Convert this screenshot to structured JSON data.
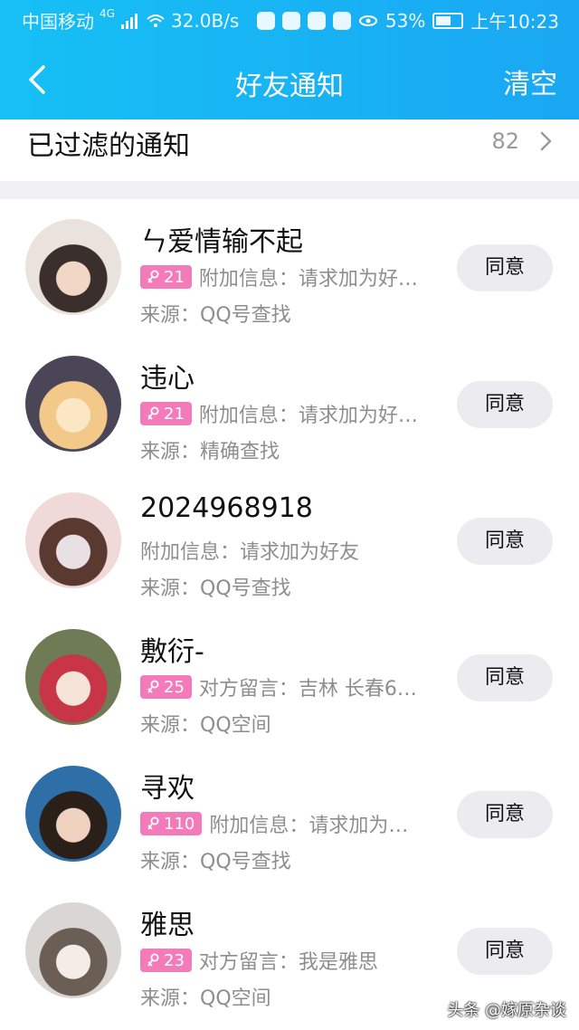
{
  "status_bar": {
    "carrier": "中国移动",
    "network": "4G",
    "speed": "32.0B/s",
    "battery": "53%",
    "time": "上午10:23"
  },
  "nav": {
    "title": "好友通知",
    "clear_label": "清空"
  },
  "filtered": {
    "label": "已过滤的通知",
    "count": "82"
  },
  "requests": [
    {
      "name": "ㄣ爱情输不起",
      "age": "21",
      "info": "附加信息：请求加为好…",
      "source": "来源：QQ号查找",
      "button": "同意",
      "avatar_colors": [
        "#e9e2dd",
        "#3a2f2c",
        "#f2d6c6"
      ]
    },
    {
      "name": "违心",
      "age": "21",
      "info": "附加信息：请求加为好…",
      "source": "来源：精确查找",
      "button": "同意",
      "avatar_colors": [
        "#4a4658",
        "#f3c98a",
        "#fbe7c4"
      ]
    },
    {
      "name": "2024968918",
      "age": "",
      "info": "附加信息：请求加为好友",
      "source": "来源：QQ号查找",
      "button": "同意",
      "avatar_colors": [
        "#f0d9d9",
        "#5a3a30",
        "#e9e0e4"
      ]
    },
    {
      "name": "敷衍-",
      "age": "25",
      "info": "对方留言：吉林 长春6…",
      "source": "来源：QQ空间",
      "button": "同意",
      "avatar_colors": [
        "#6f7b55",
        "#c73546",
        "#f4e3d6"
      ]
    },
    {
      "name": "寻欢",
      "age": "110",
      "info": "附加信息：请求加为…",
      "source": "来源：QQ号查找",
      "button": "同意",
      "avatar_colors": [
        "#2d6fa6",
        "#2b1f1a",
        "#efd1bf"
      ]
    },
    {
      "name": "雅思",
      "age": "23",
      "info": "对方留言：我是雅思",
      "source": "来源：QQ空间",
      "button": "同意",
      "avatar_colors": [
        "#d9d6d3",
        "#6b5e55",
        "#f3ece7"
      ]
    }
  ],
  "watermark": "头条 @嫁原杂谈",
  "colors": {
    "header_start": "#16c0f5",
    "header_end": "#1aa7f3",
    "age_badge": "#f47bba",
    "agree_button_bg": "#ececf0",
    "secondary_text": "#8e8e8e"
  }
}
